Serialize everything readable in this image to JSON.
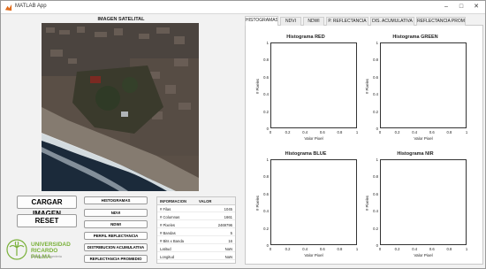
{
  "app": {
    "title": "MATLAB App",
    "accent": "#0072bd"
  },
  "image_panel": {
    "title": "IMAGEN SATELITAL"
  },
  "buttons": {
    "load": "CARGAR IMAGEN",
    "reset": "RESET",
    "histogramas": "HISTOGRAMAS",
    "ndvi": "NDVI",
    "ndwi": "NDWI",
    "perfil": "PERFIL REFLECTANCIA",
    "distribucion": "DISTRIBUCION ACUMULATIVA",
    "promedio": "REFLECTANCIA PROMEDIO"
  },
  "info_table": {
    "headers": [
      "INFORMACION",
      "VALOR"
    ],
    "rows": [
      {
        "label": "# Filas",
        "value": "1045"
      },
      {
        "label": "# Columnas",
        "value": "1661"
      },
      {
        "label": "# Pixeles",
        "value": "2469796"
      },
      {
        "label": "# Bandas",
        "value": "5"
      },
      {
        "label": "# Bits x Banda",
        "value": "16"
      },
      {
        "label": "Latitud",
        "value": "NaN"
      },
      {
        "label": "Longitud",
        "value": "NaN"
      }
    ]
  },
  "logo": {
    "line1": "UNIVERSIDAD",
    "line2": "RICARDO PALMA",
    "line3": "Facultad de Ingeniería"
  },
  "tabs": [
    {
      "label": "HISTOGRAMAS",
      "active": true
    },
    {
      "label": "NDVI",
      "active": false
    },
    {
      "label": "NDWI",
      "active": false
    },
    {
      "label": "P. REFLECTANCIA",
      "active": false
    },
    {
      "label": "DIS. ACUMULATIVA",
      "active": false
    },
    {
      "label": "REFLECTANCIA PROM",
      "active": false
    }
  ],
  "histograms": [
    {
      "title": "Histograma RED"
    },
    {
      "title": "Histograma GREEN"
    },
    {
      "title": "Histograma BLUE"
    },
    {
      "title": "Histograma NIR"
    }
  ],
  "axis": {
    "xlabel": "Valor Pixel",
    "ylabel": "# Pixeles",
    "xticks": [
      "0",
      "0.2",
      "0.4",
      "0.6",
      "0.8",
      "1"
    ],
    "yticks": [
      "0",
      "0.2",
      "0.4",
      "0.6",
      "0.8",
      "1"
    ]
  },
  "colors": {
    "water": "#1b2a3a",
    "surf": "#e8eef2",
    "sand": "#7d7468",
    "urban": "#6b5f55",
    "park": "#2f3a26"
  }
}
